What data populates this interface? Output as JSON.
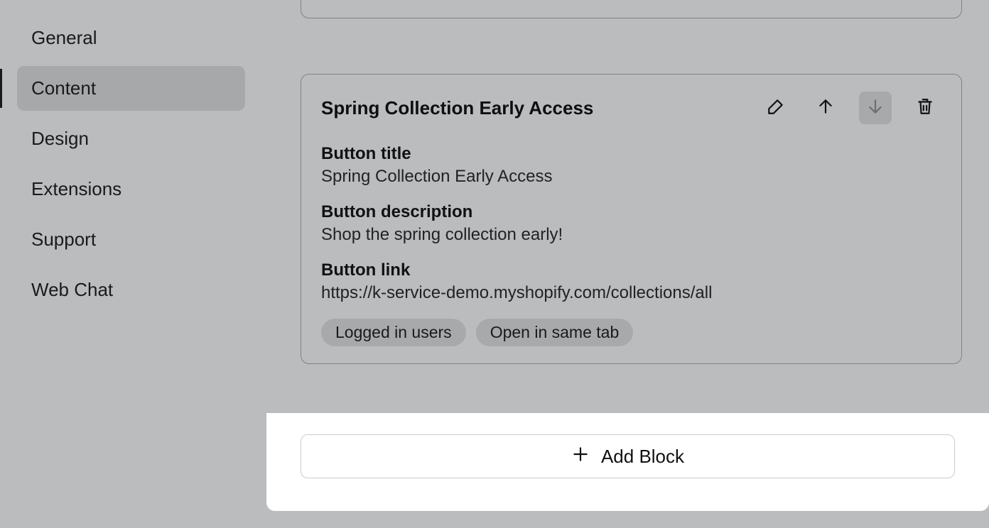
{
  "sidebar": {
    "items": [
      {
        "label": "General"
      },
      {
        "label": "Content"
      },
      {
        "label": "Design"
      },
      {
        "label": "Extensions"
      },
      {
        "label": "Support"
      },
      {
        "label": "Web Chat"
      }
    ]
  },
  "block": {
    "title": "Spring Collection Early Access",
    "fields": {
      "button_title_label": "Button title",
      "button_title_value": "Spring Collection Early Access",
      "button_description_label": "Button description",
      "button_description_value": "Shop the spring collection early!",
      "button_link_label": "Button link",
      "button_link_value": "https://k-service-demo.myshopify.com/collections/all"
    },
    "tags": [
      "Logged in users",
      "Open in same tab"
    ]
  },
  "footer": {
    "add_block_label": "Add Block"
  }
}
